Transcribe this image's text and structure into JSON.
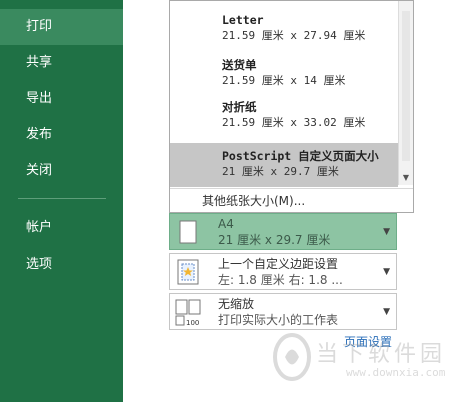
{
  "nav": {
    "items": [
      {
        "label": "打印",
        "active": true
      },
      {
        "label": "共享",
        "active": false
      },
      {
        "label": "导出",
        "active": false
      },
      {
        "label": "发布",
        "active": false
      },
      {
        "label": "关闭",
        "active": false
      }
    ],
    "bottom_items": [
      {
        "label": "帐户"
      },
      {
        "label": "选项"
      }
    ]
  },
  "paper_dropdown": {
    "options": [
      {
        "name": "Letter",
        "dimensions": "21.59 厘米 x 27.94 厘米",
        "selected": false
      },
      {
        "name": "送货单",
        "dimensions": "21.59 厘米 x 14 厘米",
        "selected": false
      },
      {
        "name": "对折纸",
        "dimensions": "21.59 厘米 x 33.02 厘米",
        "selected": false
      },
      {
        "name": "PostScript 自定义页面大小",
        "dimensions": "21 厘米 x 29.7 厘米",
        "selected": true
      }
    ],
    "more_sizes_label": "其他纸张大小(M)..."
  },
  "settings": {
    "paper": {
      "title": "A4",
      "subtitle": "21 厘米 x 29.7 厘米"
    },
    "margins": {
      "title": "上一个自定义边距设置",
      "subtitle": "左: 1.8 厘米   右: 1.8 ..."
    },
    "scaling": {
      "title": "无缩放",
      "subtitle": "打印实际大小的工作表"
    }
  },
  "page_setup_link": "页面设置",
  "watermark": {
    "text": "当下软件园",
    "url": "www.downxia.com"
  },
  "colors": {
    "sidebar": "#1f7145",
    "active_nav": "#3a8a5f",
    "selected_setting": "#8dc4a3",
    "link": "#2a6eb8"
  }
}
